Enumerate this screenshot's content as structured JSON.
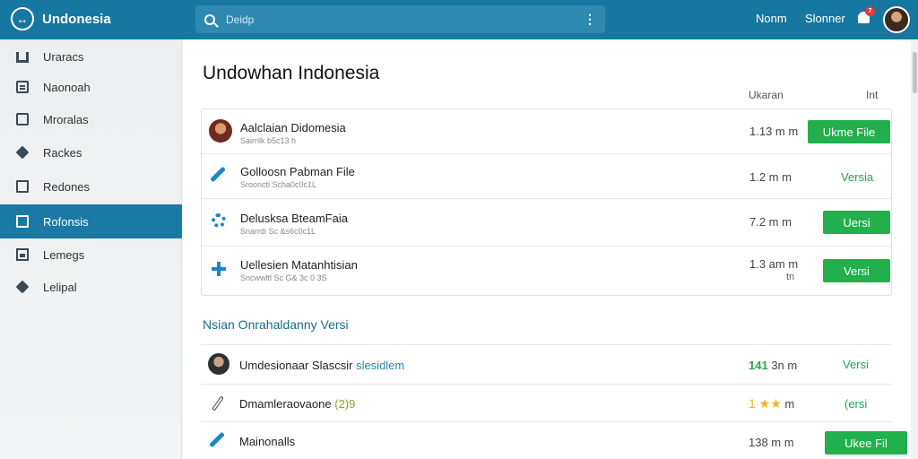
{
  "app": {
    "title": "Undonesia"
  },
  "search": {
    "placeholder": "Deidp"
  },
  "header": {
    "link1": "Nonm",
    "link2": "Slonner",
    "badge_count": "7"
  },
  "sidebar": {
    "items": [
      {
        "label": "Uraracs"
      },
      {
        "label": "Naonoah"
      },
      {
        "label": "Mroralas"
      },
      {
        "label": "Rackes"
      },
      {
        "label": "Redones"
      },
      {
        "label": "Rofonsis"
      },
      {
        "label": "Lemegs"
      },
      {
        "label": "Lelipal"
      }
    ]
  },
  "main": {
    "title": "Undowhan Indonesia",
    "col_size": "Ukaran",
    "col_action": "Int",
    "rows": [
      {
        "title": "Aalclaian Didomesia",
        "sub": "Sairrilk b5c13 h",
        "size": "1.13 m  m",
        "action": "Ukme File"
      },
      {
        "title": "Golloosn Pabman File",
        "sub": "Srooncti Scha0c0c1L",
        "size": "1.2 m  m",
        "action": "Versia"
      },
      {
        "title": "Delusksa BteamFaia",
        "sub": "Snarrdi Sc &s6c0c1L",
        "size": "7.2 m  m",
        "action": "Uersi"
      },
      {
        "title": "Uellesien Matanhtisian",
        "sub": "Sncwwltl Sc G& 3c 0 3S",
        "size": "1.3 am  m",
        "size2": "tn",
        "action": "Versi"
      }
    ],
    "section_title": "Nsian Onrahaldanny Versi",
    "list": [
      {
        "title": "Umdesionaar Slascsir",
        "title_extra": "slesidlem",
        "size_num": "141",
        "size_unit": "3n  m",
        "action": "Versi"
      },
      {
        "title": "Dmamleraovaone",
        "title_extra": "(2)9",
        "stars": "1 ★★",
        "size_unit": "m",
        "action": "(ersi"
      },
      {
        "title": "Mainonalls",
        "size": "138 m  m",
        "action": "Ukee Fil"
      }
    ]
  }
}
